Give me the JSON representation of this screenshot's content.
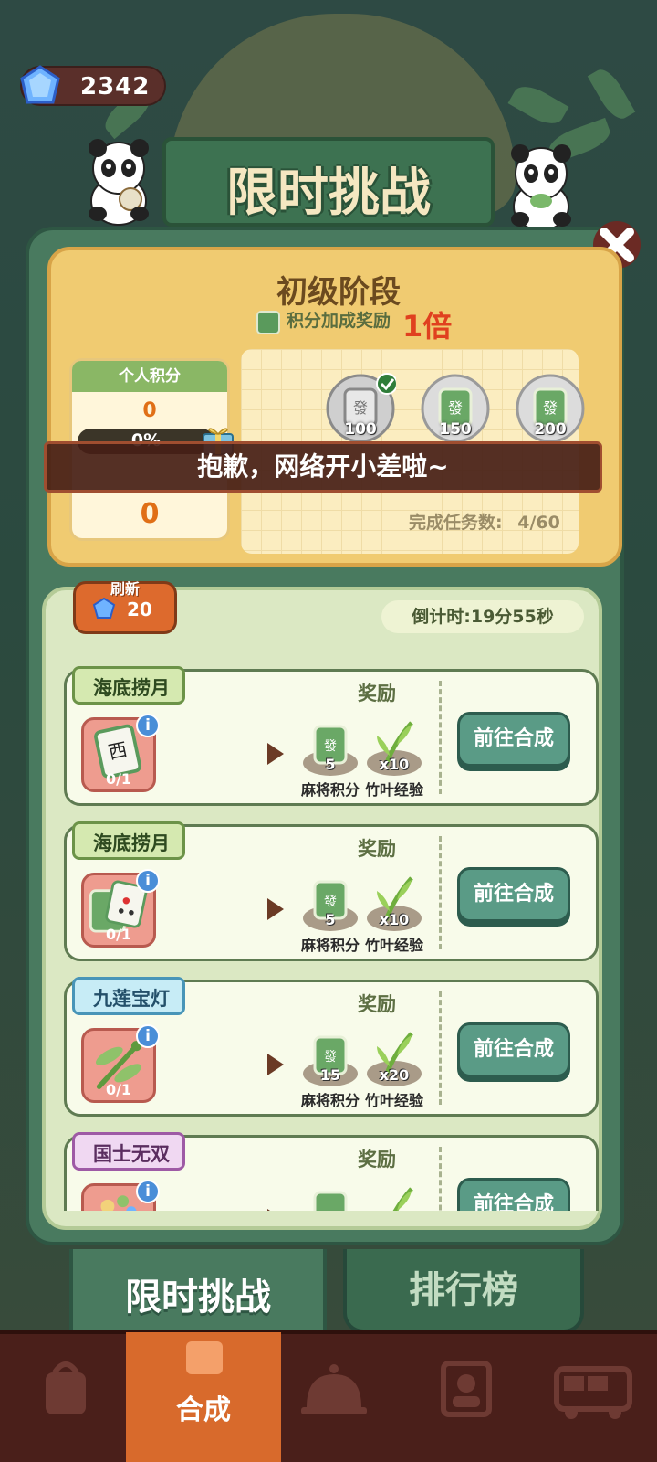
{
  "header": {
    "gem_count": "2342",
    "title": "限时挑战",
    "close_label": "×"
  },
  "stage": {
    "title": "初级阶段",
    "bonus_label": "积分加成奖励",
    "bonus_multiplier": "1倍",
    "personal_score_label": "个人积分",
    "personal_score_value": "0",
    "progress_text": "0%",
    "progress_fraction": 0,
    "second_score_value": "0",
    "milestones": [
      {
        "value": "100",
        "achieved": true
      },
      {
        "value": "150",
        "achieved": false
      },
      {
        "value": "200",
        "achieved": false
      }
    ],
    "tasks_completed_label": "完成任务数:",
    "tasks_completed_value": "4/60"
  },
  "toast": {
    "message": "抱歉，网络开小差啦~"
  },
  "task_panel": {
    "refresh_label": "刷新",
    "refresh_cost": "20",
    "countdown": "倒计时:19分55秒",
    "reward_label": "奖励",
    "go_button_label": "前往合成",
    "tasks": [
      {
        "tag": "海底捞月",
        "tag_color": "green",
        "progress": "0/1",
        "item": "mahjong-west-tile",
        "reward_points": "5",
        "reward_points_name": "麻将积分",
        "reward_exp": "x10",
        "reward_exp_name": "竹叶经验"
      },
      {
        "tag": "海底捞月",
        "tag_color": "green",
        "progress": "0/1",
        "item": "mahjong-tile-pair",
        "reward_points": "5",
        "reward_points_name": "麻将积分",
        "reward_exp": "x10",
        "reward_exp_name": "竹叶经验"
      },
      {
        "tag": "九莲宝灯",
        "tag_color": "blue",
        "progress": "0/1",
        "item": "dragonfly",
        "reward_points": "15",
        "reward_points_name": "麻将积分",
        "reward_exp": "x20",
        "reward_exp_name": "竹叶经验"
      },
      {
        "tag": "国士无双",
        "tag_color": "purple",
        "progress": "",
        "item": "mixed-items",
        "reward_points": "",
        "reward_points_name": "",
        "reward_exp": "",
        "reward_exp_name": ""
      }
    ]
  },
  "tabs": {
    "active": "限时挑战",
    "other": "排行榜"
  },
  "bottom_nav": {
    "items": [
      {
        "icon": "bag-icon",
        "label": ""
      },
      {
        "icon": "merge-icon",
        "label": "合成",
        "active": true
      },
      {
        "icon": "service-bell-icon",
        "label": ""
      },
      {
        "icon": "chef-icon",
        "label": ""
      },
      {
        "icon": "bus-icon",
        "label": ""
      }
    ]
  },
  "colors": {
    "accent_green": "#497a5f",
    "warning_red": "#e0401f",
    "stage_yellow": "#f0cb71"
  }
}
